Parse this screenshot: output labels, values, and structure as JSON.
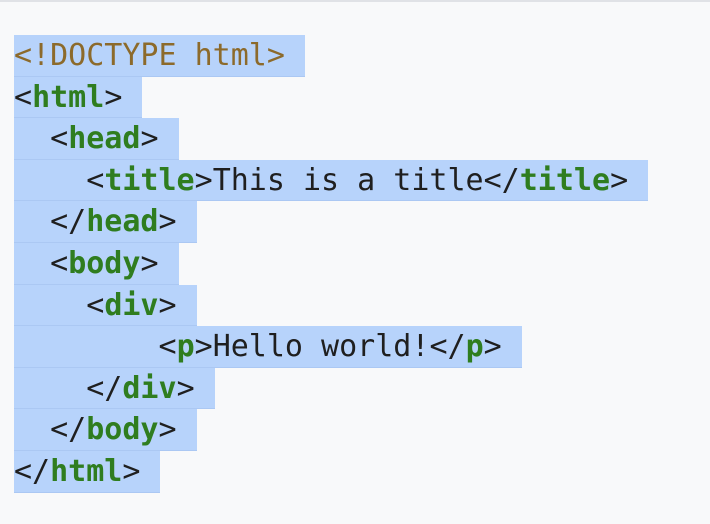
{
  "code": {
    "lines": [
      {
        "indent": "",
        "doctype": "<!DOCTYPE html>"
      },
      {
        "indent": "",
        "open": "<",
        "tag": "html",
        "close": ">"
      },
      {
        "indent": "  ",
        "open": "<",
        "tag": "head",
        "close": ">"
      },
      {
        "indent": "    ",
        "open": "<",
        "tag": "title",
        "close": ">",
        "text": "This is a title",
        "open2": "</",
        "tag2": "title",
        "close2": ">"
      },
      {
        "indent": "  ",
        "open": "</",
        "tag": "head",
        "close": ">"
      },
      {
        "indent": "  ",
        "open": "<",
        "tag": "body",
        "close": ">"
      },
      {
        "indent": "    ",
        "open": "<",
        "tag": "div",
        "close": ">"
      },
      {
        "indent": "        ",
        "open": "<",
        "tag": "p",
        "close": ">",
        "text": "Hello world!",
        "open2": "</",
        "tag2": "p",
        "close2": ">"
      },
      {
        "indent": "    ",
        "open": "</",
        "tag": "div",
        "close": ">"
      },
      {
        "indent": "  ",
        "open": "</",
        "tag": "body",
        "close": ">"
      },
      {
        "indent": "",
        "open": "</",
        "tag": "html",
        "close": ">"
      }
    ]
  },
  "colors": {
    "tag": "#2f7d1f",
    "doctype": "#8c6a2b",
    "selection": "#b7d3fb",
    "background": "#f8f9fa"
  }
}
